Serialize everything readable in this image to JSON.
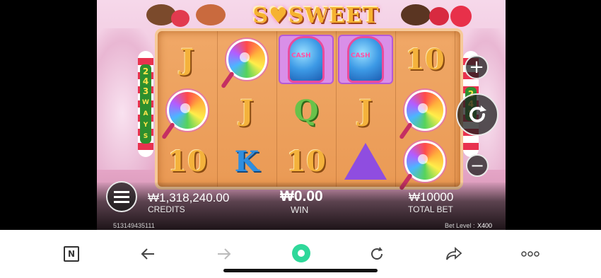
{
  "game": {
    "logo": "S♥SWEET",
    "ways_left": "243 WAYS",
    "ways_right": "243",
    "reels": [
      [
        "J",
        "lollipop",
        "10"
      ],
      [
        "lollipop",
        "J",
        "K"
      ],
      [
        "gumball",
        "Q",
        "10"
      ],
      [
        "gumball",
        "J",
        "triangle"
      ],
      [
        "10",
        "lollipop",
        "lollipop"
      ]
    ]
  },
  "controls": {
    "menu_icon": "hamburger-menu-icon",
    "plus_label": "+",
    "minus_label": "−",
    "spin_icon": "refresh-spin-icon"
  },
  "bottom": {
    "credits_value": "₩1,318,240.00",
    "credits_label": "CREDITS",
    "win_value": "₩0.00",
    "win_label": "WIN",
    "bet_value": "₩10000",
    "bet_label": "TOTAL BET",
    "session_id": "513149435111",
    "bet_level_label": "Bet Level :",
    "bet_level_value": "X400"
  },
  "browser": {
    "logo_letter": "N",
    "icons": [
      "n-logo-icon",
      "back-arrow-icon",
      "forward-arrow-icon",
      "home-dot-icon",
      "reload-icon",
      "share-icon",
      "more-dots-icon"
    ],
    "accent": "#2fd89a"
  }
}
